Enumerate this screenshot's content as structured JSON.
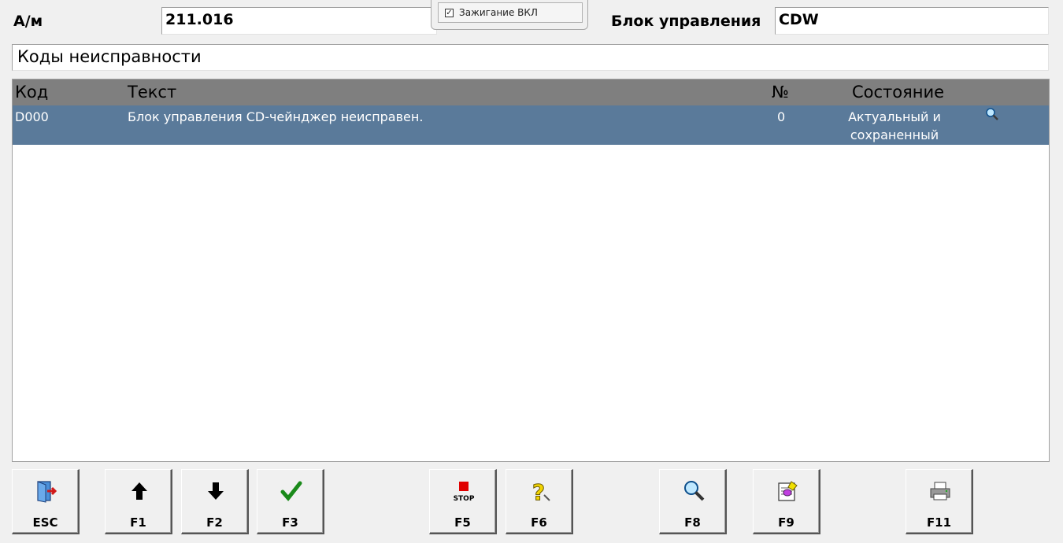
{
  "header": {
    "car_label": "А/м",
    "car_value": "211.016",
    "ecu_label": "Блок управления",
    "ecu_value": "CDW",
    "ignition_label": "Зажигание ВКЛ",
    "ignition_checked": true
  },
  "section_title": "Коды неисправности",
  "table": {
    "columns": {
      "code": "Код",
      "text": "Текст",
      "num": "№",
      "state": "Состояние"
    },
    "rows": [
      {
        "code": "D000",
        "text": "Блок управления CD-чейнджер неисправен.",
        "num": "0",
        "state_line1": "Актуальный и",
        "state_line2": "сохраненный",
        "icon": "magnifier-icon"
      }
    ]
  },
  "toolbar": {
    "esc": {
      "key": "ESC",
      "icon": "exit-door-icon"
    },
    "f1": {
      "key": "F1",
      "icon": "arrow-up-icon"
    },
    "f2": {
      "key": "F2",
      "icon": "arrow-down-icon"
    },
    "f3": {
      "key": "F3",
      "icon": "checkmark-icon"
    },
    "f5": {
      "key": "F5",
      "icon": "stop-icon",
      "icon_text": "STOP"
    },
    "f6": {
      "key": "F6",
      "icon": "help-question-icon"
    },
    "f8": {
      "key": "F8",
      "icon": "magnifier-icon"
    },
    "f9": {
      "key": "F9",
      "icon": "erase-document-icon"
    },
    "f11": {
      "key": "F11",
      "icon": "printer-icon"
    }
  },
  "colors": {
    "selected_row": "#5a7a9a",
    "table_header": "#7f7f7f",
    "background": "#f0f0f0"
  }
}
